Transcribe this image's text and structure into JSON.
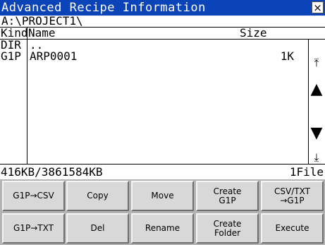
{
  "window": {
    "title": "Advanced Recipe Information",
    "close_symbol": "×"
  },
  "path": "A:\\PROJECT1\\",
  "columns": {
    "kind": "Kind",
    "name": "Name",
    "size": "Size"
  },
  "files": [
    {
      "kind": "DIR",
      "name": "..",
      "size": ""
    },
    {
      "kind": "G1P",
      "name": "ARP0001",
      "size": "1K"
    }
  ],
  "scrollbar": {
    "top_symbol": "⤒",
    "up_symbol": "▲",
    "down_symbol": "▼",
    "bottom_symbol": "⤓"
  },
  "status": {
    "memory": "416KB/3861584KB",
    "file_count": "1File"
  },
  "buttons": {
    "g1p_csv": "G1P→CSV",
    "copy": "Copy",
    "move": "Move",
    "create_g1p": "Create\nG1P",
    "csvtxt_g1p": "CSV/TXT\n→G1P",
    "g1p_txt": "G1P→TXT",
    "del": "Del",
    "rename": "Rename",
    "create_folder": "Create\nFolder",
    "execute": "Execute"
  }
}
